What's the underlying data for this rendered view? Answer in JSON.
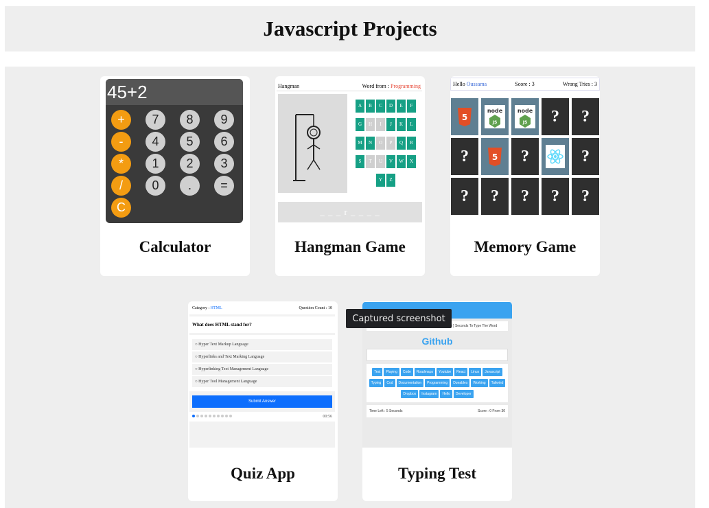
{
  "page": {
    "title": "Javascript Projects"
  },
  "projects": [
    {
      "title": "Calculator",
      "display": "45+2",
      "keys": [
        "+",
        "7",
        "8",
        "9",
        "-",
        "4",
        "5",
        "6",
        "*",
        "1",
        "2",
        "3",
        "/",
        "0",
        ".",
        "=",
        "C"
      ]
    },
    {
      "title": "Hangman Game",
      "heading": "Hangman",
      "word_from_label": "Word from :",
      "word_from_value": "Programming",
      "letters": [
        "A",
        "B",
        "C",
        "D",
        "E",
        "F",
        "G",
        "H",
        "I",
        "J",
        "K",
        "L",
        "M",
        "N",
        "O",
        "P",
        "Q",
        "R",
        "S",
        "T",
        "U",
        "V",
        "W",
        "X",
        "Y",
        "Z"
      ]
    },
    {
      "title": "Memory Game",
      "hello": "Hello",
      "player": "Oussama",
      "score": "Score : 3",
      "wrong_tries": "Wrong Tries : 3",
      "tiles": [
        "HTML",
        "NODE",
        "NODE",
        "?",
        "?",
        "?",
        "HTML",
        "?",
        "REACT",
        "?",
        "?",
        "?",
        "?",
        "?",
        "?"
      ]
    },
    {
      "title": "Quiz App",
      "category_label": "Category :",
      "category": "HTML",
      "question_count": "Question Count : 10",
      "question": "What does HTML stand for?",
      "options": [
        "Hyper Text Markup Language",
        "Hyperlinks and Text Marking Language",
        "Hyperlinking Text Management Language",
        "Hyper Tool Management Language"
      ],
      "submit": "Submit Answer",
      "timer": "00:56"
    },
    {
      "title": "Typing Test",
      "message": "You Are Playing On [ Easy ] Level & You Have [ 5 ] Seconds To Type The Word",
      "word": "Github",
      "chips": [
        "Test",
        "Playing",
        "Code",
        "Roadmaps",
        "Youtube",
        "React",
        "Linux",
        "Javascript",
        "Typing",
        "Cod",
        "Documentation",
        "Programming",
        "Dueables",
        "Working",
        "Tailwind",
        "Dropbox",
        "Instagram",
        "Hello",
        "Developer"
      ],
      "time_left": "Time Left : 5 Seconds",
      "score": "Score : 0 From 30"
    }
  ],
  "tooltip": "Captured screenshot",
  "colors": {
    "calc_op": "#f39c12",
    "hangman_on": "#16a085",
    "accent_blue": "#3aa3f0",
    "quiz_blue": "#0d6efd"
  }
}
